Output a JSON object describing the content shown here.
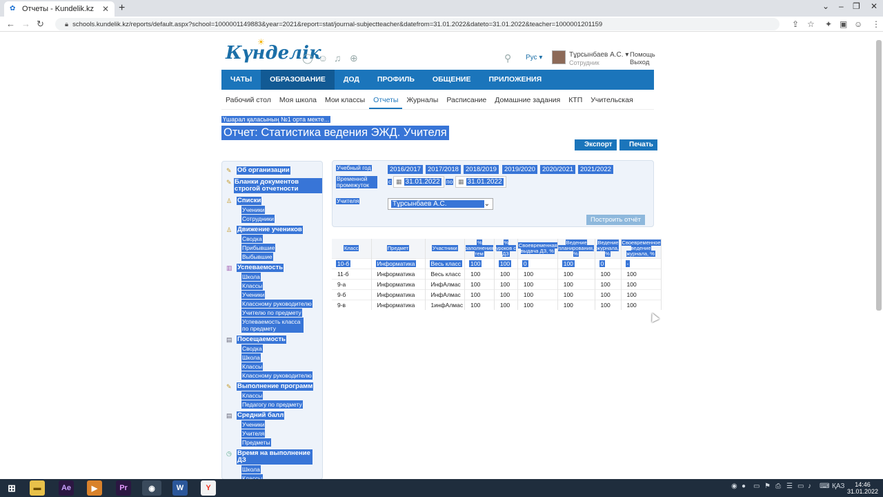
{
  "browser": {
    "tab_title": "Отчеты - Kundelik.kz",
    "url": "schools.kundelik.kz/reports/default.aspx?school=1000001149883&year=2021&report=stat/journal-subjectteacher&datefrom=31.01.2022&dateto=31.01.2022&teacher=1000001201159"
  },
  "header": {
    "logo": "Күнделік",
    "lang": "Рус",
    "user_name": "Тұрсынбаев А.С.",
    "user_role": "Сотрудник",
    "help": "Помощь",
    "logout": "Выход"
  },
  "main_nav": [
    "ЧАТЫ",
    "ОБРАЗОВАНИЕ",
    "ДОД",
    "ПРОФИЛЬ",
    "ОБЩЕНИЕ",
    "ПРИЛОЖЕНИЯ"
  ],
  "sub_nav": [
    "Рабочий стол",
    "Моя школа",
    "Мои классы",
    "Отчеты",
    "Журналы",
    "Расписание",
    "Домашние задания",
    "КТП",
    "Учительская"
  ],
  "school_name": "Үшарал қаласының №1 орта мекте...",
  "report_title": "Отчет: Статистика ведения ЭЖД. Учителя",
  "buttons": {
    "export": "Экспорт",
    "print": "Печать",
    "build": "Построить отчёт"
  },
  "sidebar": [
    {
      "title": "Об организации",
      "links": []
    },
    {
      "title": "Бланки документов строгой отчетности",
      "links": []
    },
    {
      "title": "Списки",
      "links": [
        "Ученики",
        "Сотрудники"
      ]
    },
    {
      "title": "Движение учеников",
      "links": [
        "Сводка",
        "Прибывшие",
        "Выбывшие"
      ]
    },
    {
      "title": "Успеваемость",
      "links": [
        "Школа",
        "Классы",
        "Ученики",
        "Классному руководителю",
        "Учителю по предмету",
        "Успеваемость класса по предмету"
      ]
    },
    {
      "title": "Посещаемость",
      "links": [
        "Сводка",
        "Школа",
        "Классы",
        "Классному руководителю"
      ]
    },
    {
      "title": "Выполнение программ",
      "links": [
        "Классы",
        "Педагогу по предмету"
      ]
    },
    {
      "title": "Средний балл",
      "links": [
        "Ученики",
        "Учителя",
        "Предметы"
      ]
    },
    {
      "title": "Время на выполнение ДЗ",
      "links": [
        "Школа",
        "Классы"
      ]
    }
  ],
  "filter": {
    "year_label": "Учебный год",
    "years": [
      "2016/2017",
      "2017/2018",
      "2018/2019",
      "2019/2020",
      "2020/2021",
      "2021/2022"
    ],
    "period_label": "Временной промежуток",
    "from_label": "с",
    "to_label": "по",
    "date_from": "31.01.2022",
    "date_to": "31.01.2022",
    "teacher_label": "Учителя",
    "teacher_value": "Тұрсынбаев А.С."
  },
  "table": {
    "headers": [
      "Класс",
      "Предмет",
      "Участники",
      "% заполнения тем",
      "% уроков с ДЗ",
      "Своевременная выдача ДЗ, %",
      "Ведение планирования, %",
      "Ведение журнала, %",
      "Своевременное ведение журнала, %"
    ],
    "rows": [
      [
        "10-б",
        "Информатика",
        "Весь класс",
        "100",
        "100",
        "0",
        "100",
        "0",
        "-"
      ],
      [
        "11-б",
        "Информатика",
        "Весь класс",
        "100",
        "100",
        "100",
        "100",
        "100",
        "100"
      ],
      [
        "9-а",
        "Информатика",
        "ИнфАлмас",
        "100",
        "100",
        "100",
        "100",
        "100",
        "100"
      ],
      [
        "9-б",
        "Информатика",
        "ИнфАлмас",
        "100",
        "100",
        "100",
        "100",
        "100",
        "100"
      ],
      [
        "9-в",
        "Информатика",
        "1инфАлмас",
        "100",
        "100",
        "100",
        "100",
        "100",
        "100"
      ]
    ]
  },
  "taskbar": {
    "lang": "ҚАЗ",
    "time": "14:46",
    "date": "31.01.2022"
  }
}
